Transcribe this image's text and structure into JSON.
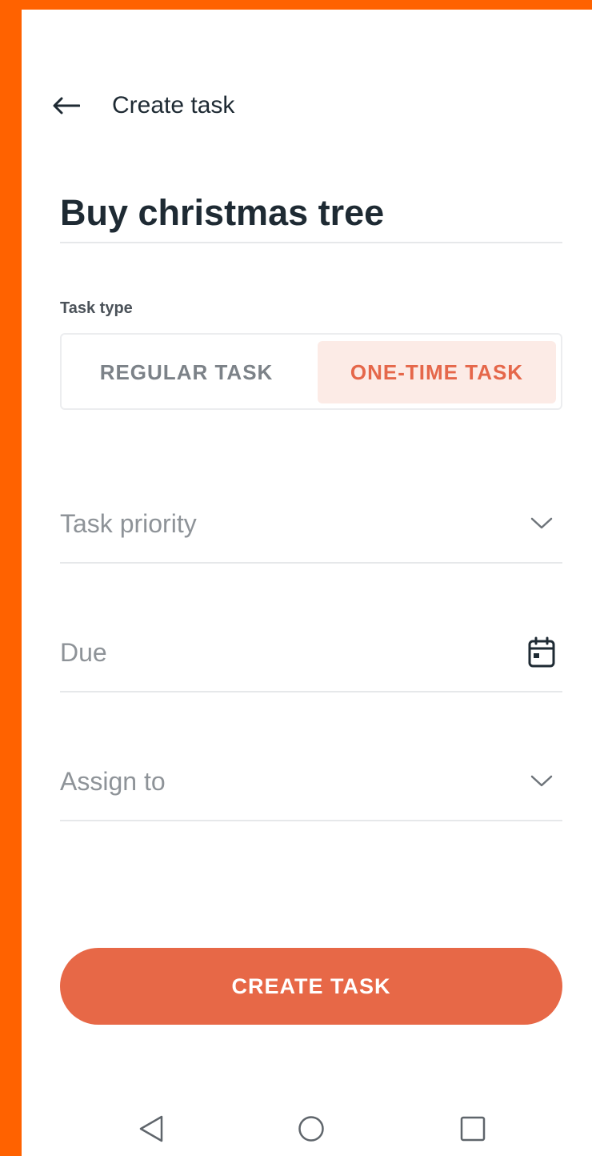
{
  "header": {
    "title": "Create task"
  },
  "task": {
    "name": "Buy christmas tree"
  },
  "task_type": {
    "label": "Task type",
    "options": [
      "REGULAR TASK",
      "ONE-TIME TASK"
    ],
    "selected": "ONE-TIME TASK"
  },
  "fields": {
    "priority": {
      "placeholder": "Task priority",
      "icon": "chevron-down-icon"
    },
    "due": {
      "placeholder": "Due",
      "icon": "calendar-icon"
    },
    "assign": {
      "placeholder": "Assign to",
      "icon": "chevron-down-icon"
    }
  },
  "cta": {
    "label": "CREATE TASK"
  },
  "nav": {
    "icons": [
      "back-triangle-icon",
      "home-circle-icon",
      "recents-square-icon"
    ]
  },
  "colors": {
    "accent": "#E76847",
    "accent_light": "#FCEBE6",
    "frame": "#FF6200",
    "text_dark": "#1E2A33"
  }
}
